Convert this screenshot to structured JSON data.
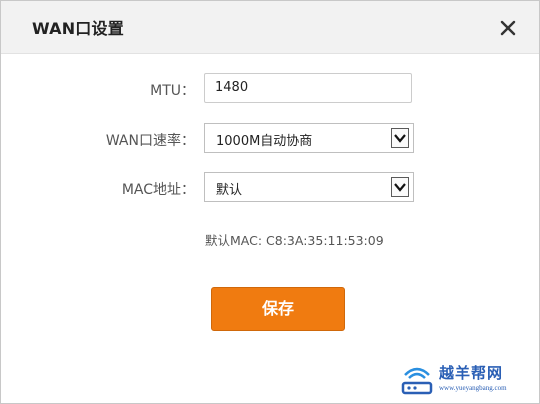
{
  "dialog": {
    "title": "WAN口设置"
  },
  "form": {
    "mtu_label": "MTU：",
    "mtu_value": "1480",
    "speed_label": "WAN口速率：",
    "speed_value": "1000M自动协商",
    "mac_label": "MAC地址：",
    "mac_value": "默认",
    "default_mac_info": "默认MAC: C8:3A:35:11:53:09"
  },
  "actions": {
    "save_label": "保存"
  },
  "watermark": {
    "text": "越羊帮网",
    "url": "www.yueyangbang.com"
  },
  "icons": {
    "close": "close-icon",
    "dropdown": "chevron-down-icon"
  },
  "colors": {
    "accent": "#f07b10",
    "header_bg": "#f2f2f2",
    "watermark": "#2a5fb5"
  }
}
